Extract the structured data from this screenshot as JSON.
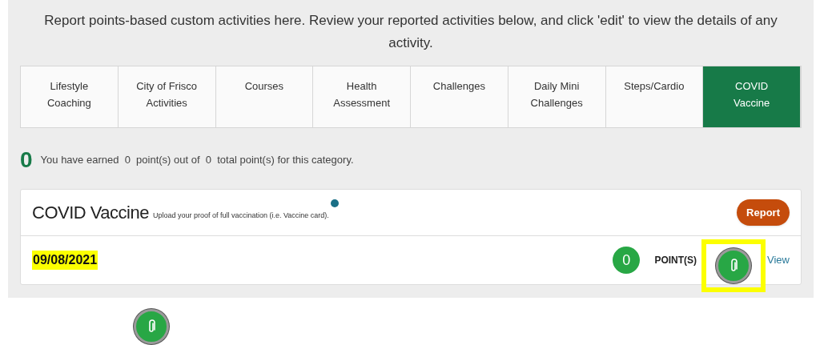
{
  "intro": "Report points-based custom activities here. Review your reported activities below, and click 'edit' to view the details of any activity.",
  "tabs": [
    {
      "label": "Lifestyle Coaching",
      "selected": false
    },
    {
      "label": "City of Frisco Activities",
      "selected": false
    },
    {
      "label": "Courses",
      "selected": false
    },
    {
      "label": "Health Assessment",
      "selected": false
    },
    {
      "label": "Challenges",
      "selected": false
    },
    {
      "label": "Daily Mini Challenges",
      "selected": false
    },
    {
      "label": "Steps/Cardio",
      "selected": false
    },
    {
      "label": "COVID Vaccine",
      "selected": true
    }
  ],
  "summary": {
    "big_points": "0",
    "parts": [
      "You have earned",
      "0",
      "point(s) out of",
      "0",
      "total point(s) for this category."
    ]
  },
  "card": {
    "title": "COVID Vaccine",
    "subtitle": "Upload your proof of full vaccination (i.e. Vaccine card).",
    "report_button": "Report",
    "entry": {
      "date": "09/08/2021",
      "date_highlighted": true,
      "points": "0",
      "points_label": "POINT(S)",
      "attachment_highlighted": true,
      "view_link": "View"
    }
  }
}
